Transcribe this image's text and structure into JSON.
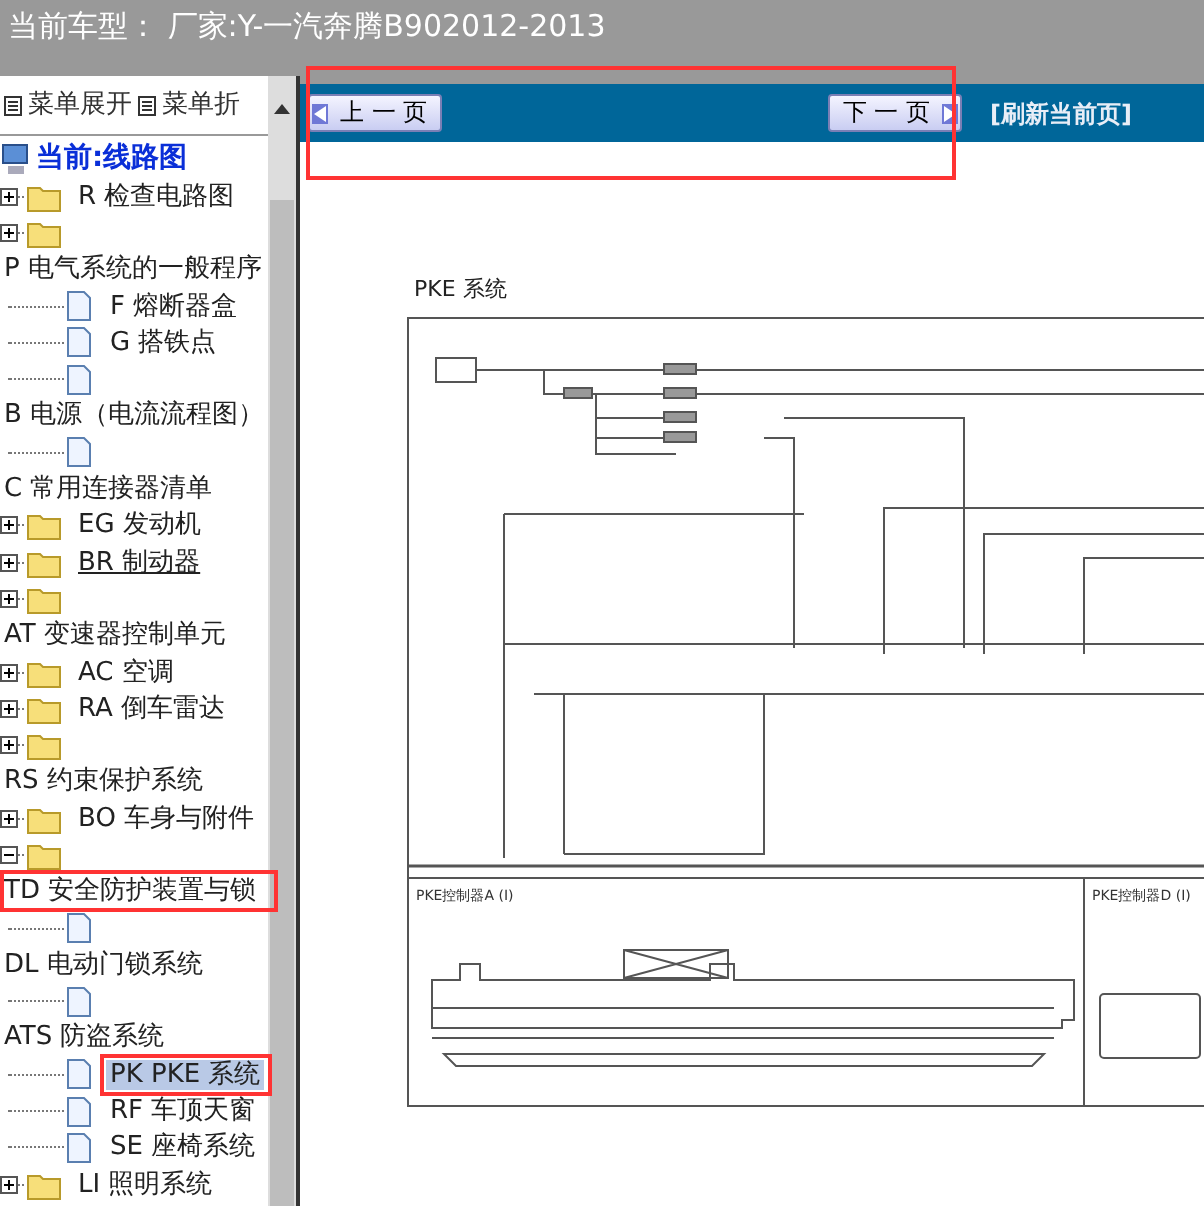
{
  "header": {
    "title": "当前车型： 厂家:Y-一汽奔腾B902012-2013"
  },
  "sidebar": {
    "menu": [
      {
        "label": "菜单展开"
      },
      {
        "label": "菜单折"
      }
    ],
    "current": {
      "label": "当前:线路图"
    },
    "tree": [
      {
        "kind": "folder",
        "label": "R 检查电路图",
        "expanded": false,
        "selected": false,
        "hovered": false
      },
      {
        "kind": "folder",
        "expanded": false,
        "selected": false
      },
      {
        "kind": "heading",
        "label": "P 电气系统的一般程序",
        "selected": false,
        "hovered": false,
        "children": [
          {
            "kind": "doc",
            "label": "F 熔断器盒",
            "selected": false,
            "hovered": false
          },
          {
            "kind": "doc",
            "label": "G 搭铁点",
            "selected": false,
            "hovered": false
          },
          {
            "kind": "doc",
            "selected": false
          }
        ]
      },
      {
        "kind": "heading",
        "label": "B 电源（电流流程图）",
        "selected": false,
        "hovered": false,
        "children": [
          {
            "kind": "doc",
            "selected": false
          }
        ]
      },
      {
        "kind": "heading",
        "label": "C 常用连接器清单",
        "selected": false,
        "hovered": false
      },
      {
        "kind": "folder",
        "label": "EG 发动机",
        "expanded": false,
        "selected": false,
        "hovered": false
      },
      {
        "kind": "folder",
        "label": "BR 制动器",
        "expanded": false,
        "selected": false,
        "hovered": true
      },
      {
        "kind": "folder",
        "expanded": false,
        "selected": false
      },
      {
        "kind": "heading",
        "label": "AT 变速器控制单元",
        "selected": false,
        "hovered": false
      },
      {
        "kind": "folder",
        "label": "AC 空调",
        "expanded": false,
        "selected": false,
        "hovered": false
      },
      {
        "kind": "folder",
        "label": "RA 倒车雷达",
        "expanded": false,
        "selected": false,
        "hovered": false
      },
      {
        "kind": "folder",
        "expanded": false,
        "selected": false
      },
      {
        "kind": "heading",
        "label": "RS 约束保护系统",
        "selected": false,
        "hovered": false
      },
      {
        "kind": "folder",
        "label": "BO 车身与附件",
        "expanded": false,
        "selected": false,
        "hovered": false
      },
      {
        "kind": "folder",
        "expanded": true,
        "selected": false
      },
      {
        "kind": "heading",
        "label": "TD 安全防护装置与锁",
        "selected": false,
        "hovered": false,
        "children": [
          {
            "kind": "doc",
            "selected": false
          }
        ]
      },
      {
        "kind": "heading",
        "label": "DL 电动门锁系统",
        "selected": false,
        "hovered": false,
        "children": [
          {
            "kind": "doc",
            "selected": false
          }
        ]
      },
      {
        "kind": "heading",
        "label": "ATS 防盗系统",
        "selected": false,
        "hovered": false,
        "children": [
          {
            "kind": "doc",
            "label": "PK PKE 系统",
            "selected": true,
            "hovered": false
          },
          {
            "kind": "doc",
            "label": "RF 车顶天窗",
            "selected": false,
            "hovered": false
          },
          {
            "kind": "doc",
            "label": "SE 座椅系统",
            "selected": false,
            "hovered": false
          }
        ]
      },
      {
        "kind": "folder",
        "label": "LI 照明系统",
        "expanded": false,
        "selected": false,
        "hovered": false
      }
    ]
  },
  "toolbar": {
    "prev": "上 一 页",
    "next": "下 一 页",
    "refresh": "[刷新当前页]"
  },
  "document": {
    "title": "PKE 系统",
    "panels": [
      {
        "label": "PKE控制器A (I)"
      },
      {
        "label": "PKE控制器D (I)"
      }
    ]
  }
}
